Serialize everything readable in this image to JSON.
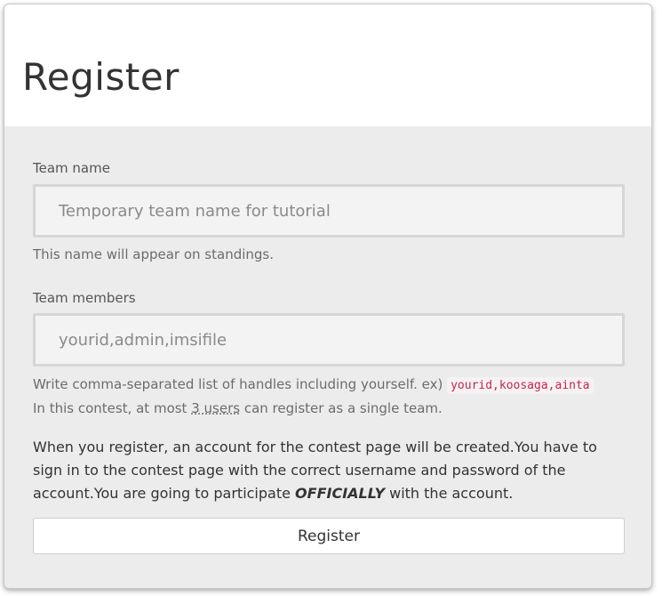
{
  "header": {
    "title": "Register"
  },
  "team_name": {
    "label": "Team name",
    "value": "",
    "placeholder": "Temporary team name for tutorial",
    "help": "This name will appear on standings."
  },
  "team_members": {
    "label": "Team members",
    "value": "",
    "placeholder": "yourid,admin,imsifile",
    "help_prefix": "Write comma-separated list of handles including yourself. ex)",
    "help_example": "yourid,koosaga,ainta",
    "limit_prefix": "In this contest, at most",
    "limit_value": "3 users",
    "limit_suffix": "can register as a single team."
  },
  "notice": {
    "text_before": "When you register, an account for the contest page will be created.You have to sign in to the contest page with the correct username and password of the account.You are going to participate",
    "emphasis": "OFFICIALLY",
    "text_after": "with the account."
  },
  "submit": {
    "label": "Register"
  }
}
